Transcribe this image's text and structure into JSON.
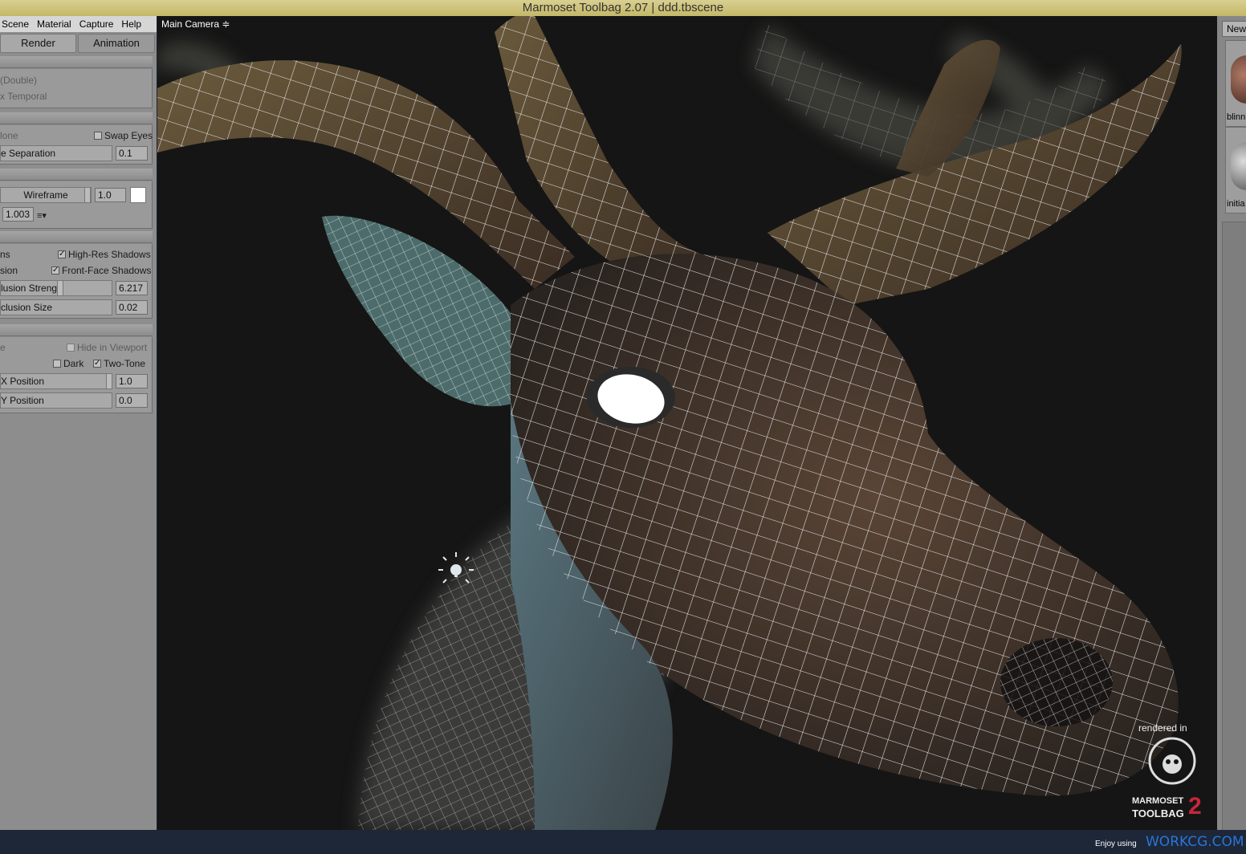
{
  "window": {
    "title": "Marmoset Toolbag 2.07  |  ddd.tbscene"
  },
  "menu": [
    "Scene",
    "Material",
    "Capture",
    "Help"
  ],
  "tabs": {
    "render": "Render",
    "animation": "Animation"
  },
  "antialias": {
    "mode1": "(Double)",
    "mode2": "x Temporal"
  },
  "stereo": {
    "mode": "lone",
    "swap_eyes": "Swap Eyes",
    "separation_label": "e Separation",
    "separation_value": "0.1"
  },
  "wireframe": {
    "label": "Wireframe",
    "value": "1.0",
    "color": "#ffffff",
    "offset_value": "1.003",
    "menu_icon": "≡▾"
  },
  "shadows": {
    "left1": "ns",
    "high_res": "High-Res Shadows",
    "left2": "sion",
    "front_face": "Front-Face Shadows",
    "occlusion_strength_label": "lusion Strengtl",
    "occlusion_strength_value": "6.217",
    "occlusion_size_label": "clusion Size",
    "occlusion_size_value": "0.02"
  },
  "background": {
    "left1": "e",
    "hide_viewport": "Hide in Viewport",
    "dark": "Dark",
    "two_tone": "Two-Tone",
    "x_label": "X Position",
    "x_value": "1.0",
    "y_label": "Y Position",
    "y_value": "0.0"
  },
  "viewport": {
    "camera": "Main Camera ≑",
    "logo_top": "rendered in",
    "logo_bottom1": "MARMOSET",
    "logo_bottom2": "TOOLBAG",
    "logo_ver": "2"
  },
  "materials": {
    "new_label": "New",
    "mat1": "blinn",
    "mat2": "initia"
  },
  "footer": {
    "enjoy": "Enjoy using",
    "site": "WORKCG.COM"
  },
  "colors": {
    "title_bg": "#d2c67c",
    "panel_bg": "#8d8d8d",
    "viewport_bg": "#151515",
    "footer_bg": "#1d2738",
    "site_link": "#2b74d8"
  }
}
